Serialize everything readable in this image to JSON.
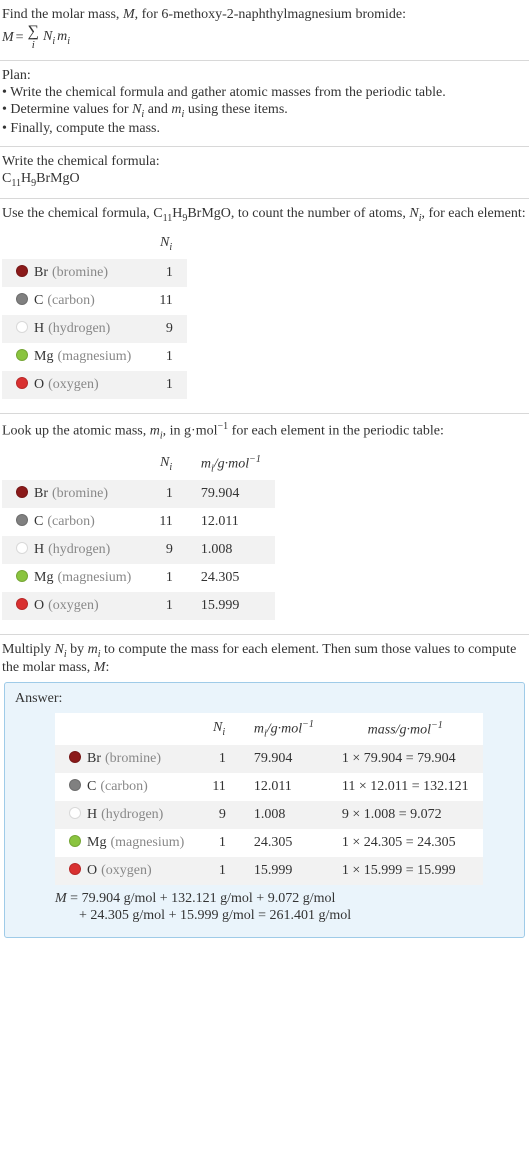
{
  "intro": {
    "line1_pre": "Find the molar mass, ",
    "line1_M": "M",
    "line1_rest": ", for 6-methoxy-2-naphthylmagnesium bromide:",
    "eq_M": "M",
    "eq_equals": " = ",
    "eq_sigma": "∑",
    "eq_index": "i",
    "eq_N": "N",
    "eq_Nsub": "i",
    "eq_m": "m",
    "eq_msub": "i"
  },
  "plan": {
    "title": "Plan:",
    "b1": "• Write the chemical formula and gather atomic masses from the periodic table.",
    "b2_pre": "• Determine values for ",
    "b2_N": "N",
    "b2_Nsub": "i",
    "b2_and": " and ",
    "b2_m": "m",
    "b2_msub": "i",
    "b2_rest": " using these items.",
    "b3": "• Finally, compute the mass."
  },
  "formula_section": {
    "header": "Write the chemical formula:",
    "f_pre": "C",
    "f_c": "11",
    "f_mid": "H",
    "f_h": "9",
    "f_rest": "BrMgO"
  },
  "count_section": {
    "text_pre": "Use the chemical formula, C",
    "c11": "11",
    "text_mid1": "H",
    "h9": "9",
    "text_mid2": "BrMgO, to count the number of atoms, ",
    "N": "N",
    "Nsub": "i",
    "text_post": ", for each element:",
    "header_Ni": "N",
    "header_Ni_sub": "i",
    "rows": [
      {
        "color": "#8b1a1a",
        "sym": "Br",
        "name": "(bromine)",
        "n": "1"
      },
      {
        "color": "#808080",
        "sym": "C",
        "name": "(carbon)",
        "n": "11"
      },
      {
        "color": "#ffffff",
        "sym": "H",
        "name": "(hydrogen)",
        "n": "9"
      },
      {
        "color": "#8ac43f",
        "sym": "Mg",
        "name": "(magnesium)",
        "n": "1"
      },
      {
        "color": "#d93030",
        "sym": "O",
        "name": "(oxygen)",
        "n": "1"
      }
    ]
  },
  "mass_section": {
    "text_pre": "Look up the atomic mass, ",
    "m": "m",
    "msub": "i",
    "text_mid": ", in g·mol",
    "exp": "−1",
    "text_post": " for each element in the periodic table:",
    "hdr_Ni": "N",
    "hdr_Ni_sub": "i",
    "hdr_mi_pre": "m",
    "hdr_mi_sub": "i",
    "hdr_mi_unit": "/g·mol",
    "hdr_mi_exp": "−1",
    "rows": [
      {
        "color": "#8b1a1a",
        "sym": "Br",
        "name": "(bromine)",
        "n": "1",
        "m": "79.904"
      },
      {
        "color": "#808080",
        "sym": "C",
        "name": "(carbon)",
        "n": "11",
        "m": "12.011"
      },
      {
        "color": "#ffffff",
        "sym": "H",
        "name": "(hydrogen)",
        "n": "9",
        "m": "1.008"
      },
      {
        "color": "#8ac43f",
        "sym": "Mg",
        "name": "(magnesium)",
        "n": "1",
        "m": "24.305"
      },
      {
        "color": "#d93030",
        "sym": "O",
        "name": "(oxygen)",
        "n": "1",
        "m": "15.999"
      }
    ]
  },
  "final_section": {
    "text_pre": "Multiply ",
    "N": "N",
    "Nsub": "i",
    "by": " by ",
    "m": "m",
    "msub": "i",
    "text_mid": " to compute the mass for each element. Then sum those values to compute the molar mass, ",
    "M": "M",
    "colon": ":",
    "answer_label": "Answer:",
    "hdr_Ni": "N",
    "hdr_Ni_sub": "i",
    "hdr_mi_pre": "m",
    "hdr_mi_sub": "i",
    "hdr_mi_unit": "/g·mol",
    "hdr_mi_exp": "−1",
    "hdr_mass": "mass/g·mol",
    "hdr_mass_exp": "−1",
    "rows": [
      {
        "color": "#8b1a1a",
        "sym": "Br",
        "name": "(bromine)",
        "n": "1",
        "m": "79.904",
        "mass": "1 × 79.904 = 79.904"
      },
      {
        "color": "#808080",
        "sym": "C",
        "name": "(carbon)",
        "n": "11",
        "m": "12.011",
        "mass": "11 × 12.011 = 132.121"
      },
      {
        "color": "#ffffff",
        "sym": "H",
        "name": "(hydrogen)",
        "n": "9",
        "m": "1.008",
        "mass": "9 × 1.008 = 9.072"
      },
      {
        "color": "#8ac43f",
        "sym": "Mg",
        "name": "(magnesium)",
        "n": "1",
        "m": "24.305",
        "mass": "1 × 24.305 = 24.305"
      },
      {
        "color": "#d93030",
        "sym": "O",
        "name": "(oxygen)",
        "n": "1",
        "m": "15.999",
        "mass": "1 × 15.999 = 15.999"
      }
    ],
    "result_M": "M",
    "result_line1": " = 79.904 g/mol + 132.121 g/mol + 9.072 g/mol",
    "result_line2": "+ 24.305 g/mol + 15.999 g/mol = 261.401 g/mol"
  }
}
